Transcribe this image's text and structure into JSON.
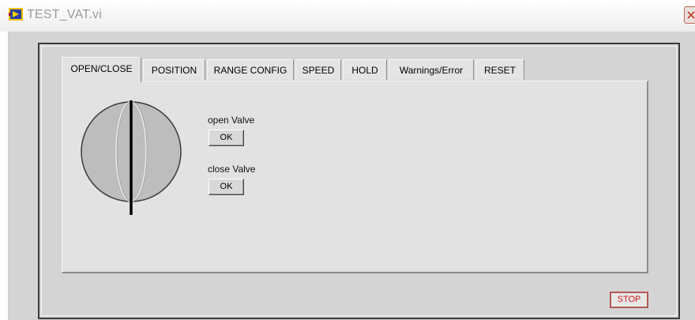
{
  "window": {
    "title": "TEST_VAT.vi",
    "icon": "labview-vi-icon",
    "close_icon": "close-icon"
  },
  "tabs": [
    {
      "label": "OPEN/CLOSE",
      "active": true
    },
    {
      "label": "POSITION",
      "active": false
    },
    {
      "label": "RANGE CONFIG",
      "active": false
    },
    {
      "label": "SPEED",
      "active": false
    },
    {
      "label": "HOLD",
      "active": false
    },
    {
      "label": "Warnings/Error",
      "active": false
    },
    {
      "label": "RESET",
      "active": false
    }
  ],
  "panel": {
    "valve_indicator": {
      "icon": "valve-ball-icon",
      "state": "closed"
    },
    "open_valve": {
      "label": "open Valve",
      "button": "OK"
    },
    "close_valve": {
      "label": "close Valve",
      "button": "OK"
    }
  },
  "stop_button": "STOP",
  "colors": {
    "window_bg": "#d4d4d4",
    "panel_bg": "#e2e2e2",
    "stop_text": "#d01818",
    "stop_border": "#b25a55",
    "valve_fill": "#bdbdbd"
  }
}
